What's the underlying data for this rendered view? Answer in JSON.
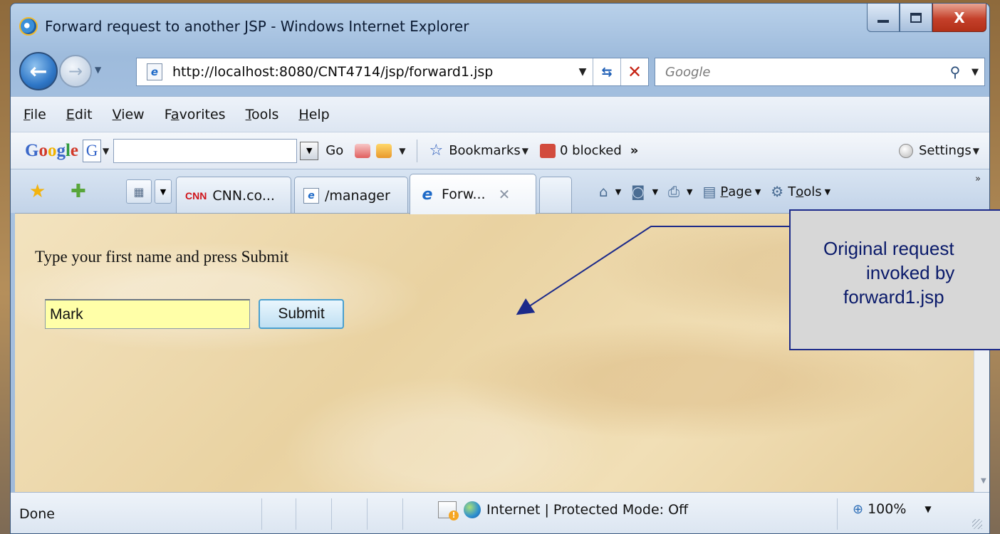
{
  "window": {
    "title": "Forward request to another JSP - Windows Internet Explorer",
    "controls": {
      "close_glyph": "X"
    }
  },
  "address": {
    "url": "http://localhost:8080/CNT4714/jsp/forward1.jsp",
    "search_placeholder": "Google"
  },
  "menu": {
    "items": [
      {
        "pre": "",
        "key": "F",
        "post": "ile"
      },
      {
        "pre": "",
        "key": "E",
        "post": "dit"
      },
      {
        "pre": "",
        "key": "V",
        "post": "iew"
      },
      {
        "pre": "F",
        "key": "a",
        "post": "vorites"
      },
      {
        "pre": "",
        "key": "T",
        "post": "ools"
      },
      {
        "pre": "",
        "key": "H",
        "post": "elp"
      }
    ]
  },
  "google_toolbar": {
    "logo": "Google",
    "g_letter": "G",
    "go_label": "Go",
    "bookmarks_label": "Bookmarks",
    "blocked_label": "0 blocked",
    "more_glyph": "»",
    "settings_label": "Settings"
  },
  "tabs": [
    {
      "label": "CNN.co...",
      "icon": "cnn-icon",
      "icon_text": "CNN"
    },
    {
      "label": "/manager",
      "icon": "ie-page-icon",
      "icon_text": "e"
    },
    {
      "label": "Forw...",
      "icon": "ie-icon",
      "icon_text": "e",
      "active": true
    }
  ],
  "command_bar": {
    "page_pre": "",
    "page_key": "P",
    "page_post": "age",
    "tools_pre": "T",
    "tools_key": "o",
    "tools_post": "ols"
  },
  "page": {
    "prompt": "Type your first name and press Submit",
    "name_value": "Mark",
    "submit_label": "Submit"
  },
  "status": {
    "text": "Done",
    "zone": "Internet | Protected Mode: Off",
    "zoom": "100%"
  },
  "callout": {
    "lines": [
      "Original request",
      "invoked by",
      "forward1.jsp"
    ]
  },
  "colors": {
    "callout_border": "#1c2a8a",
    "callout_text": "#0a1a6a",
    "arrow": "#1c2a8a",
    "input_bg": "#ffffa8"
  }
}
